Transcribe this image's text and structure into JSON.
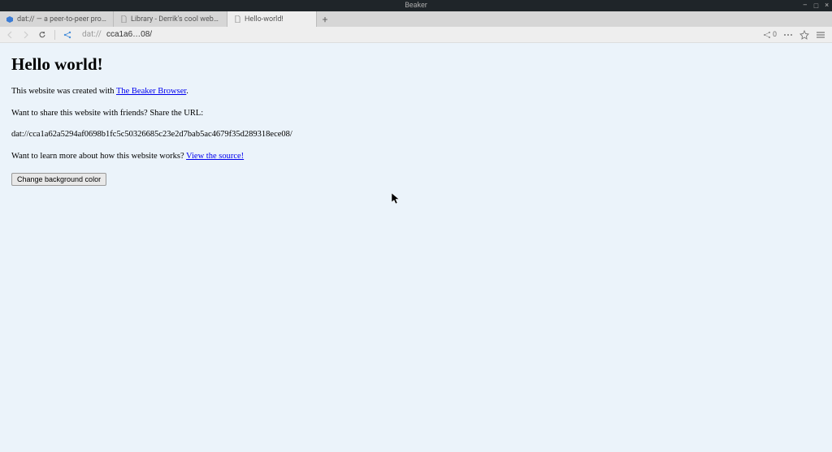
{
  "window": {
    "title": "Beaker"
  },
  "tabs": [
    {
      "label": "dat:// — a peer-to-peer protocol",
      "icon": "hexagon"
    },
    {
      "label": "Library - Derrik's cool website thing",
      "icon": "file"
    },
    {
      "label": "Hello-world!",
      "icon": "file",
      "active": true
    }
  ],
  "address": {
    "scheme": "dat://",
    "value": "cca1a6…08/"
  },
  "toolbar": {
    "peer_count": "0"
  },
  "page": {
    "heading": "Hello world!",
    "created_prefix": "This website was created with ",
    "created_link": "The Beaker Browser",
    "created_suffix": ".",
    "share_text": "Want to share this website with friends? Share the URL:",
    "dat_url": "dat://cca1a62a5294af0698b1fc5c50326685c23e2d7bab5ac4679f35d289318ece08/",
    "learn_prefix": "Want to learn more about how this website works? ",
    "learn_link": "View the source!",
    "button_label": "Change background color"
  }
}
